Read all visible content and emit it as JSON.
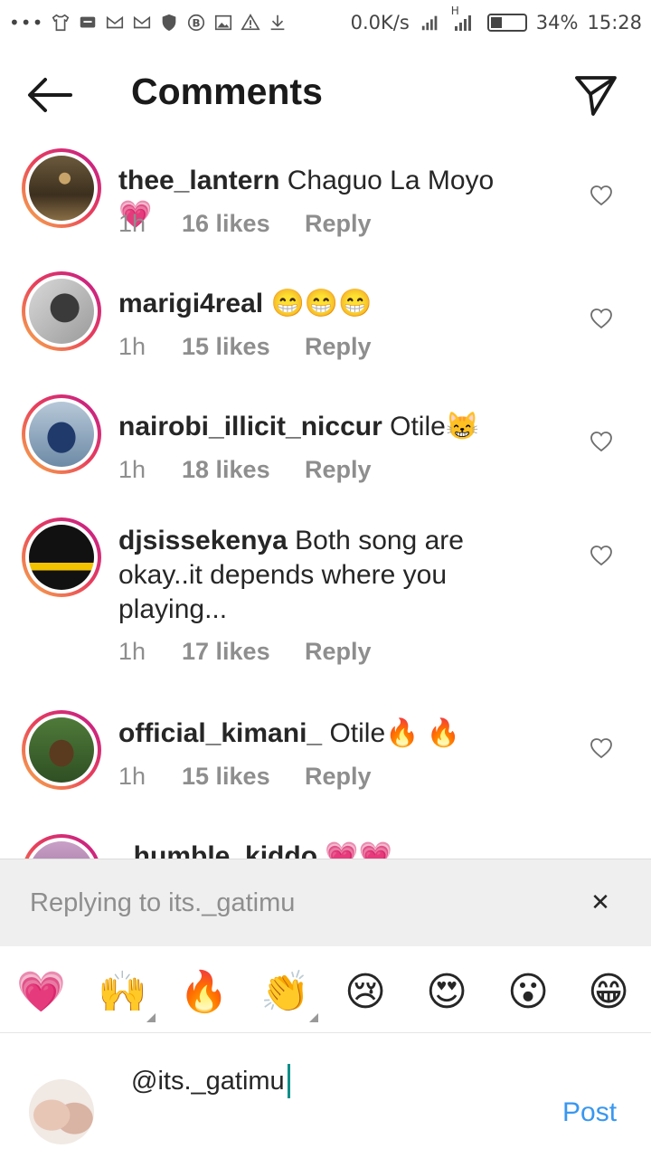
{
  "status_bar": {
    "speed": "0.0K/s",
    "network_label": "H",
    "battery": "34%",
    "battery_level": 0.34,
    "time": "15:28"
  },
  "header": {
    "title": "Comments"
  },
  "comments": [
    {
      "username": "thee_lantern",
      "text": "Chaguo La Moyo",
      "emoji": "💗",
      "time": "1h",
      "likes": "16 likes",
      "reply": "Reply"
    },
    {
      "username": "marigi4real",
      "text": "",
      "emoji": "😁😁😁",
      "time": "1h",
      "likes": "15 likes",
      "reply": "Reply"
    },
    {
      "username": "nairobi_illicit_niccur",
      "text": "Otile",
      "emoji": "😸",
      "time": "1h",
      "likes": "18 likes",
      "reply": "Reply"
    },
    {
      "username": "djsissekenya",
      "text": "Both song are okay..it depends where you playing...",
      "emoji": "",
      "time": "1h",
      "likes": "17 likes",
      "reply": "Reply"
    },
    {
      "username": "official_kimani_",
      "text": "Otile",
      "emoji": "🔥 🔥",
      "time": "1h",
      "likes": "15 likes",
      "reply": "Reply"
    },
    {
      "username": "_humble_kiddo",
      "text": "",
      "emoji": "💗💗",
      "time": "",
      "likes": "",
      "reply": ""
    }
  ],
  "reply_banner": {
    "text": "Replying to its._gatimu"
  },
  "emoji_bar": [
    "💗",
    "🙌",
    "🔥",
    "👏",
    "😢",
    "😍",
    "😮",
    "😁"
  ],
  "composer": {
    "value": "@its._gatimu",
    "post_label": "Post"
  },
  "colors": {
    "accent": "#3897f0",
    "ring_start": "#f7b24a",
    "ring_end": "#c0198f",
    "heart": "#e84d88"
  }
}
